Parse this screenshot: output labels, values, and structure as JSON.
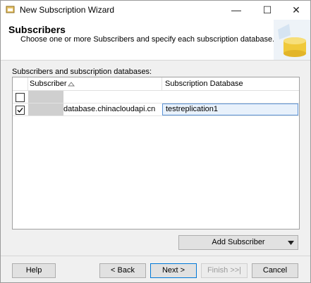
{
  "window": {
    "title": "New Subscription Wizard"
  },
  "header": {
    "title": "Subscribers",
    "subtitle": "Choose one or more Subscribers and specify each subscription database."
  },
  "grid": {
    "label": "Subscribers and subscription databases:",
    "columns": [
      "Subscriber",
      "Subscription Database"
    ],
    "rows": [
      {
        "checked": false,
        "subscriber": "",
        "database": ""
      },
      {
        "checked": true,
        "subscriber": "database.chinacloudapi.cn",
        "database": "testreplication1"
      }
    ]
  },
  "buttons": {
    "add_subscriber": "Add Subscriber",
    "help": "Help",
    "back": "< Back",
    "next": "Next >",
    "finish": "Finish >>|",
    "cancel": "Cancel"
  },
  "colors": {
    "accent": "#0078d7",
    "selected_cell": "#e8f1fb"
  },
  "icons": [
    "app-icon",
    "minimize-icon",
    "maximize-icon",
    "close-icon",
    "database-graphic-icon",
    "sort-ascending-icon",
    "checkbox-icon",
    "dropdown-arrow-icon"
  ]
}
